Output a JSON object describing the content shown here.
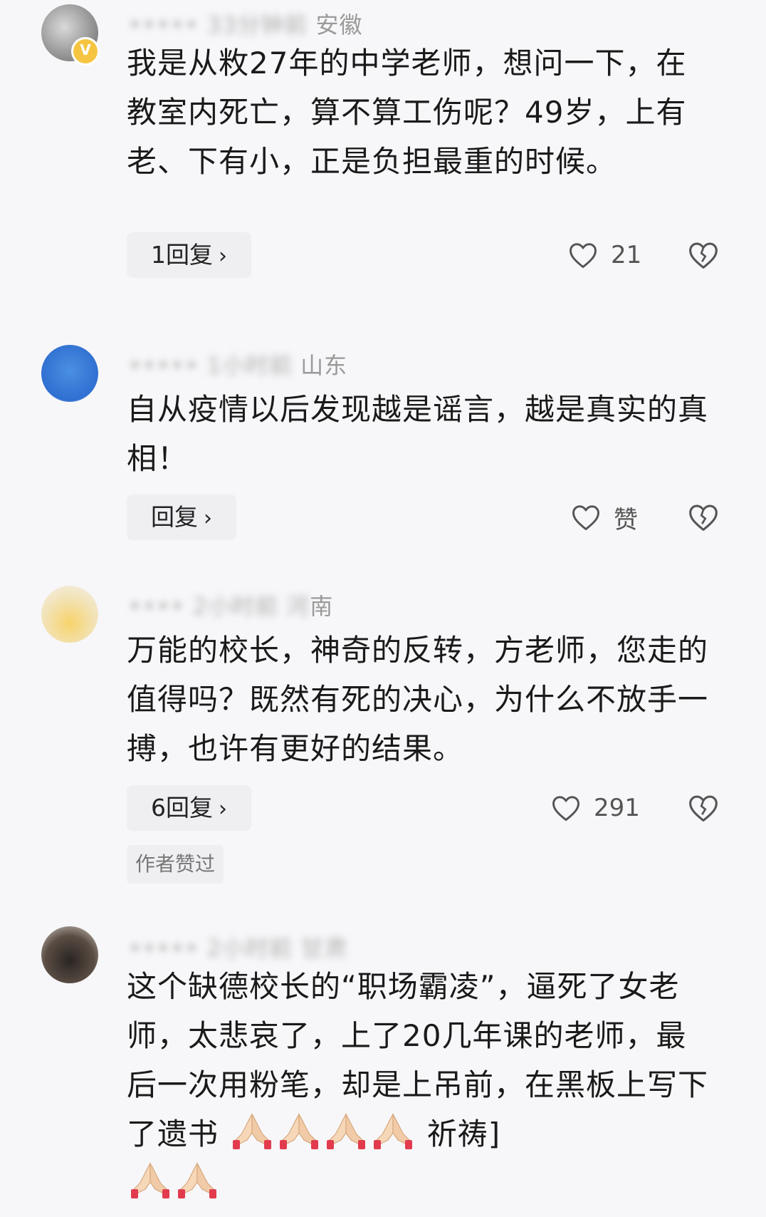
{
  "comments": [
    {
      "meta_hidden": "••••• 33分钟前",
      "location": "安徽",
      "text": "我是从敉27年的中学老师，想问一下，在教室内死亡，算不算工伤呢？49岁，上有老、下有小，正是负担最重的时候。",
      "reply_label": "1回复",
      "likes": "21"
    },
    {
      "meta_hidden": "••••• 1小时前",
      "location": "山东",
      "text": "自从疫情以后发现越是谣言，越是真实的真相！",
      "reply_label": "回复",
      "likes": "赞"
    },
    {
      "meta_hidden": "•••• 2小时前 河",
      "location": "南",
      "text": "万能的校长，神奇的反转，方老师，您走的值得吗？既然有死的决心，为什么不放手一搏，也许有更好的结果。",
      "reply_label": "6回复",
      "likes": "291",
      "author_liked": "作者赞过"
    },
    {
      "meta_hidden": "••••• 2小时前 甘肃",
      "location": "",
      "text_main": "这个缺德校长的“职场霸凌”，逼死了女老师，太悲哀了，上了20几年课的老师，最后一次用粉笔，却是上吊前，在黑板上写下了遗书",
      "text_tail": "祈祷]"
    }
  ],
  "colors": {
    "background": "#f7f7f9",
    "button_bg": "#efeff2",
    "text": "#1a1a1a",
    "meta": "#9a9a9a"
  },
  "icons": {
    "like": "heart-outline-icon",
    "dislike": "broken-heart-icon",
    "pray": "praying-hands-emoji"
  }
}
